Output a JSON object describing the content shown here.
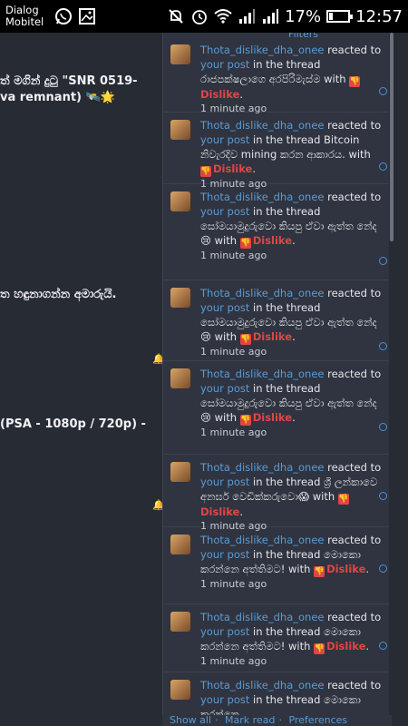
{
  "status_bar": {
    "carrier_line1": "Dialog",
    "carrier_line2": "Mobitel",
    "battery_percent": "17%",
    "battery_level": 0.17,
    "time": "12:57"
  },
  "background_page": {
    "lines": [
      "ත් මගින් දුටු \"SNR 0519-",
      "va remnant) 🛰️🌟",
      "ත හඳුනාගන්න අමාරුයි.",
      "(PSA - 1080p / 720p) -"
    ]
  },
  "popup": {
    "filters_label": "Filters",
    "notifications": [
      {
        "user": "Thota_dislike_dha_onee",
        "reacted": " reacted to ",
        "post_link": "your post",
        "thread": " in the thread රාජපක්ෂලාගෙ අරපිරිමැස්ම with ",
        "reaction": "Dislike",
        "end": ".",
        "time": "1 minute ago"
      },
      {
        "user": "Thota_dislike_dha_onee",
        "reacted": " reacted to ",
        "post_link": "your post",
        "thread": " in the thread Bitcoin නිවැරදිව mining කරන ආකාරය. with ",
        "reaction": "Dislike",
        "end": ".",
        "time": "1 minute ago"
      },
      {
        "user": "Thota_dislike_dha_onee",
        "reacted": " reacted to ",
        "post_link": "your post",
        "thread": " in the thread සෝමයාමුදුරුවො කියපු ඒවා ඇත්ත නේද😢 with ",
        "reaction": "Dislike",
        "end": ".",
        "time": "1 minute ago"
      },
      {
        "user": "Thota_dislike_dha_onee",
        "reacted": " reacted to ",
        "post_link": "your post",
        "thread": " in the thread සෝමයාමුදුරුවො කියපු ඒවා ඇත්ත නේද😢 with ",
        "reaction": "Dislike",
        "end": ".",
        "time": "1 minute ago"
      },
      {
        "user": "Thota_dislike_dha_onee",
        "reacted": " reacted to ",
        "post_link": "your post",
        "thread": " in the thread සෝමයාමුදුරුවො කියපු ඒවා ඇත්ත නේද😢 with ",
        "reaction": "Dislike",
        "end": ".",
        "time": "1 minute ago"
      },
      {
        "user": "Thota_dislike_dha_onee",
        "reacted": " reacted to ",
        "post_link": "your post",
        "thread": " in the thread ශ්‍රී ලන්කාවෙ අනර්ඝ වෙඩික්කරුවො😱 with ",
        "reaction": "Dislike",
        "end": ".",
        "time": "1 minute ago"
      },
      {
        "user": "Thota_dislike_dha_onee",
        "reacted": " reacted to ",
        "post_link": "your post",
        "thread": " in the thread මොකො කරන්නෙ අත්තිමට! with ",
        "reaction": "Dislike",
        "end": ".",
        "time": "1 minute ago"
      },
      {
        "user": "Thota_dislike_dha_onee",
        "reacted": " reacted to ",
        "post_link": "your post",
        "thread": " in the thread මොකො කරන්නෙ අත්තිමට! with ",
        "reaction": "Dislike",
        "end": ".",
        "time": "1 minute ago"
      },
      {
        "user": "Thota_dislike_dha_onee",
        "reacted": " reacted to ",
        "post_link": "your post",
        "thread": " in the thread මොකො කරන්නෙ ",
        "reaction": "",
        "end": "",
        "time": ""
      }
    ],
    "footer": {
      "show_all": "Show all",
      "sep1": "·",
      "mark_read": "Mark read",
      "sep2": "·",
      "preferences": "Preferences"
    }
  },
  "colors": {
    "link": "#5a9bd5",
    "dislike": "#e04646",
    "popup_bg": "#2f3440",
    "page_bg": "#272b34"
  }
}
